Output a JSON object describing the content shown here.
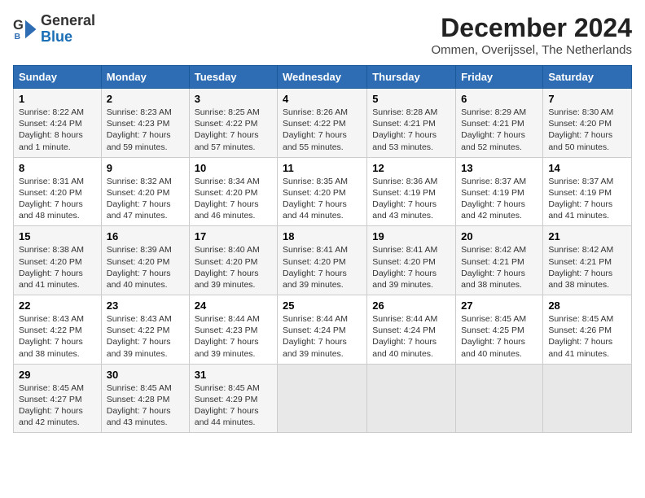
{
  "header": {
    "logo_general": "General",
    "logo_blue": "Blue",
    "month_title": "December 2024",
    "subtitle": "Ommen, Overijssel, The Netherlands"
  },
  "days_of_week": [
    "Sunday",
    "Monday",
    "Tuesday",
    "Wednesday",
    "Thursday",
    "Friday",
    "Saturday"
  ],
  "weeks": [
    [
      {
        "day": "1",
        "info": "Sunrise: 8:22 AM\nSunset: 4:24 PM\nDaylight: 8 hours\nand 1 minute."
      },
      {
        "day": "2",
        "info": "Sunrise: 8:23 AM\nSunset: 4:23 PM\nDaylight: 7 hours\nand 59 minutes."
      },
      {
        "day": "3",
        "info": "Sunrise: 8:25 AM\nSunset: 4:22 PM\nDaylight: 7 hours\nand 57 minutes."
      },
      {
        "day": "4",
        "info": "Sunrise: 8:26 AM\nSunset: 4:22 PM\nDaylight: 7 hours\nand 55 minutes."
      },
      {
        "day": "5",
        "info": "Sunrise: 8:28 AM\nSunset: 4:21 PM\nDaylight: 7 hours\nand 53 minutes."
      },
      {
        "day": "6",
        "info": "Sunrise: 8:29 AM\nSunset: 4:21 PM\nDaylight: 7 hours\nand 52 minutes."
      },
      {
        "day": "7",
        "info": "Sunrise: 8:30 AM\nSunset: 4:20 PM\nDaylight: 7 hours\nand 50 minutes."
      }
    ],
    [
      {
        "day": "8",
        "info": "Sunrise: 8:31 AM\nSunset: 4:20 PM\nDaylight: 7 hours\nand 48 minutes."
      },
      {
        "day": "9",
        "info": "Sunrise: 8:32 AM\nSunset: 4:20 PM\nDaylight: 7 hours\nand 47 minutes."
      },
      {
        "day": "10",
        "info": "Sunrise: 8:34 AM\nSunset: 4:20 PM\nDaylight: 7 hours\nand 46 minutes."
      },
      {
        "day": "11",
        "info": "Sunrise: 8:35 AM\nSunset: 4:20 PM\nDaylight: 7 hours\nand 44 minutes."
      },
      {
        "day": "12",
        "info": "Sunrise: 8:36 AM\nSunset: 4:19 PM\nDaylight: 7 hours\nand 43 minutes."
      },
      {
        "day": "13",
        "info": "Sunrise: 8:37 AM\nSunset: 4:19 PM\nDaylight: 7 hours\nand 42 minutes."
      },
      {
        "day": "14",
        "info": "Sunrise: 8:37 AM\nSunset: 4:19 PM\nDaylight: 7 hours\nand 41 minutes."
      }
    ],
    [
      {
        "day": "15",
        "info": "Sunrise: 8:38 AM\nSunset: 4:20 PM\nDaylight: 7 hours\nand 41 minutes."
      },
      {
        "day": "16",
        "info": "Sunrise: 8:39 AM\nSunset: 4:20 PM\nDaylight: 7 hours\nand 40 minutes."
      },
      {
        "day": "17",
        "info": "Sunrise: 8:40 AM\nSunset: 4:20 PM\nDaylight: 7 hours\nand 39 minutes."
      },
      {
        "day": "18",
        "info": "Sunrise: 8:41 AM\nSunset: 4:20 PM\nDaylight: 7 hours\nand 39 minutes."
      },
      {
        "day": "19",
        "info": "Sunrise: 8:41 AM\nSunset: 4:20 PM\nDaylight: 7 hours\nand 39 minutes."
      },
      {
        "day": "20",
        "info": "Sunrise: 8:42 AM\nSunset: 4:21 PM\nDaylight: 7 hours\nand 38 minutes."
      },
      {
        "day": "21",
        "info": "Sunrise: 8:42 AM\nSunset: 4:21 PM\nDaylight: 7 hours\nand 38 minutes."
      }
    ],
    [
      {
        "day": "22",
        "info": "Sunrise: 8:43 AM\nSunset: 4:22 PM\nDaylight: 7 hours\nand 38 minutes."
      },
      {
        "day": "23",
        "info": "Sunrise: 8:43 AM\nSunset: 4:22 PM\nDaylight: 7 hours\nand 39 minutes."
      },
      {
        "day": "24",
        "info": "Sunrise: 8:44 AM\nSunset: 4:23 PM\nDaylight: 7 hours\nand 39 minutes."
      },
      {
        "day": "25",
        "info": "Sunrise: 8:44 AM\nSunset: 4:24 PM\nDaylight: 7 hours\nand 39 minutes."
      },
      {
        "day": "26",
        "info": "Sunrise: 8:44 AM\nSunset: 4:24 PM\nDaylight: 7 hours\nand 40 minutes."
      },
      {
        "day": "27",
        "info": "Sunrise: 8:45 AM\nSunset: 4:25 PM\nDaylight: 7 hours\nand 40 minutes."
      },
      {
        "day": "28",
        "info": "Sunrise: 8:45 AM\nSunset: 4:26 PM\nDaylight: 7 hours\nand 41 minutes."
      }
    ],
    [
      {
        "day": "29",
        "info": "Sunrise: 8:45 AM\nSunset: 4:27 PM\nDaylight: 7 hours\nand 42 minutes."
      },
      {
        "day": "30",
        "info": "Sunrise: 8:45 AM\nSunset: 4:28 PM\nDaylight: 7 hours\nand 43 minutes."
      },
      {
        "day": "31",
        "info": "Sunrise: 8:45 AM\nSunset: 4:29 PM\nDaylight: 7 hours\nand 44 minutes."
      },
      null,
      null,
      null,
      null
    ]
  ]
}
